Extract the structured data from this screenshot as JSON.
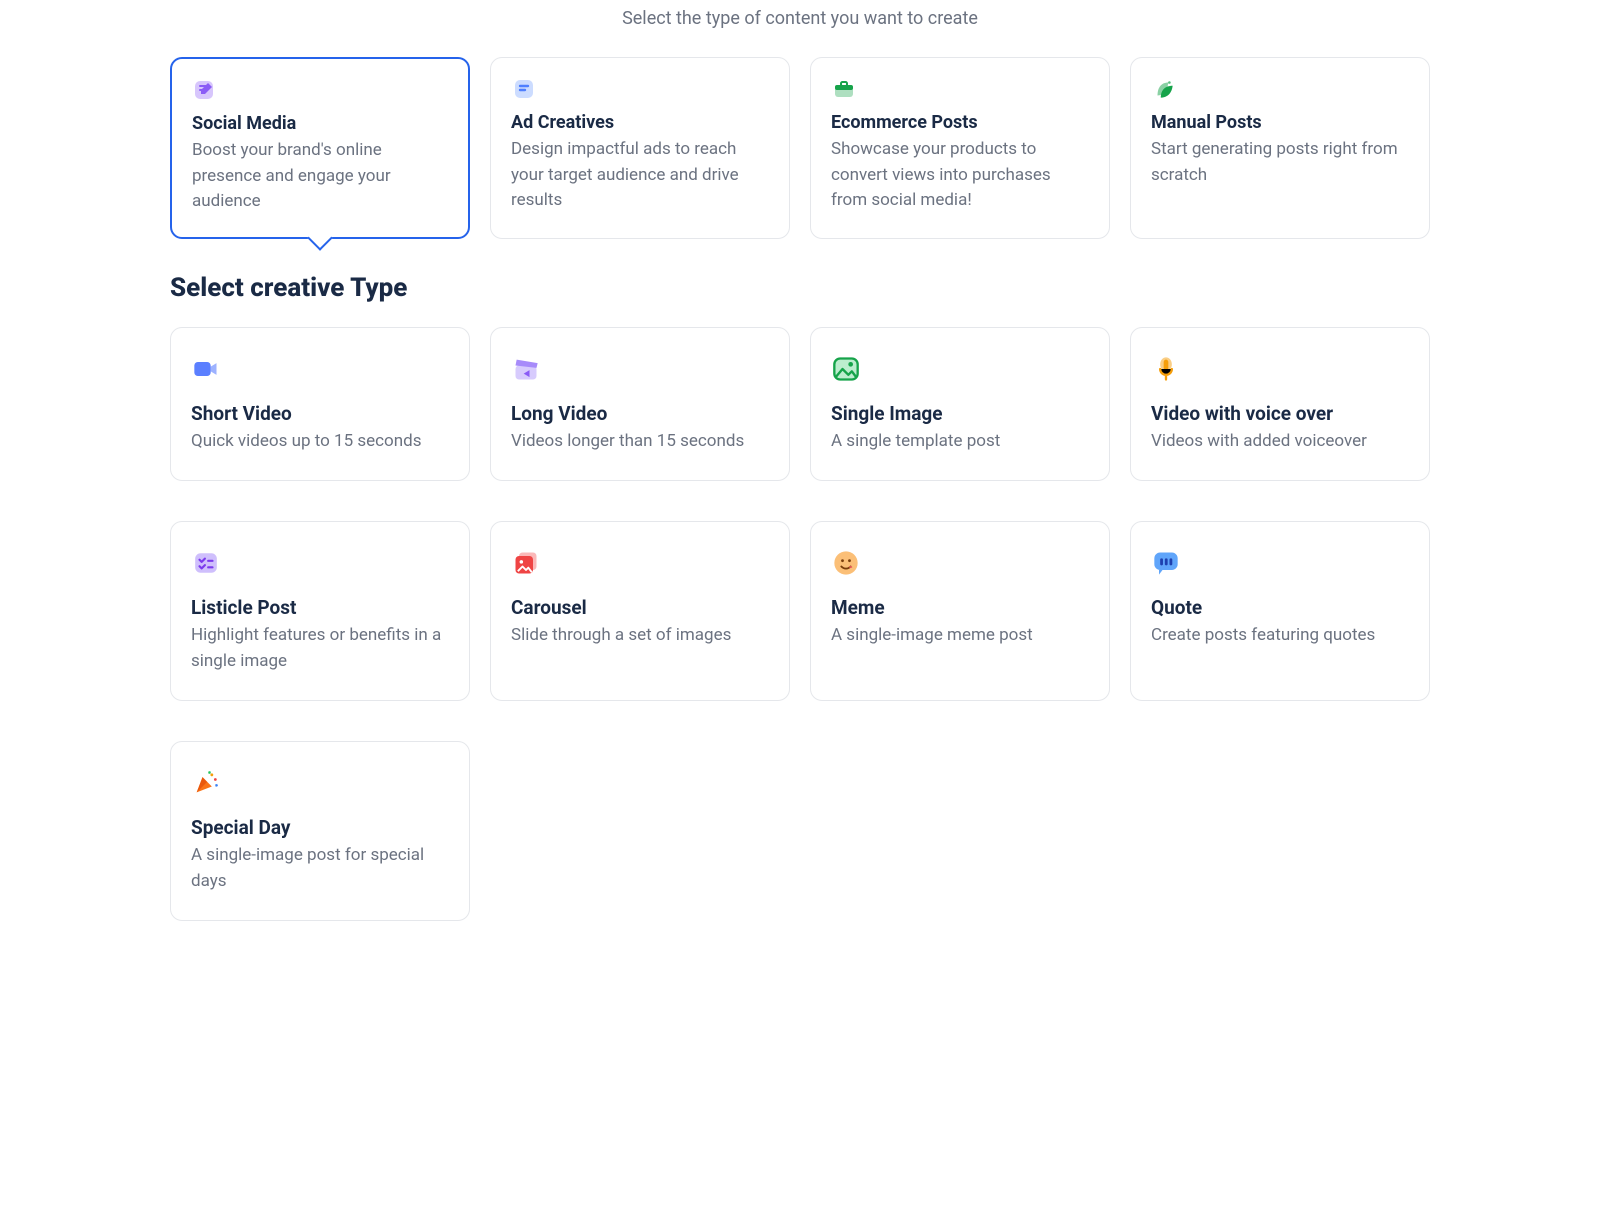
{
  "subtitle": "Select the type of content you want to create",
  "contentTypes": [
    {
      "title": "Social Media",
      "desc": "Boost your brand's online presence and engage your audience"
    },
    {
      "title": "Ad Creatives",
      "desc": "Design impactful ads to reach your target audience and drive results"
    },
    {
      "title": "Ecommerce Posts",
      "desc": "Showcase your products to convert views into purchases from social media!"
    },
    {
      "title": "Manual Posts",
      "desc": "Start generating posts right from scratch"
    }
  ],
  "sectionTitle": "Select creative Type",
  "creativeTypes": [
    {
      "title": "Short Video",
      "desc": "Quick videos up to 15 seconds"
    },
    {
      "title": "Long Video",
      "desc": "Videos longer than 15 seconds"
    },
    {
      "title": "Single Image",
      "desc": "A single template post"
    },
    {
      "title": "Video with voice over",
      "desc": "Videos with added voiceover"
    },
    {
      "title": "Listicle Post",
      "desc": "Highlight features or benefits in a single image"
    },
    {
      "title": "Carousel",
      "desc": "Slide through a set of images"
    },
    {
      "title": "Meme",
      "desc": "A single-image meme post"
    },
    {
      "title": "Quote",
      "desc": "Create posts featuring quotes"
    },
    {
      "title": "Special Day",
      "desc": "A single-image post for special days"
    }
  ]
}
